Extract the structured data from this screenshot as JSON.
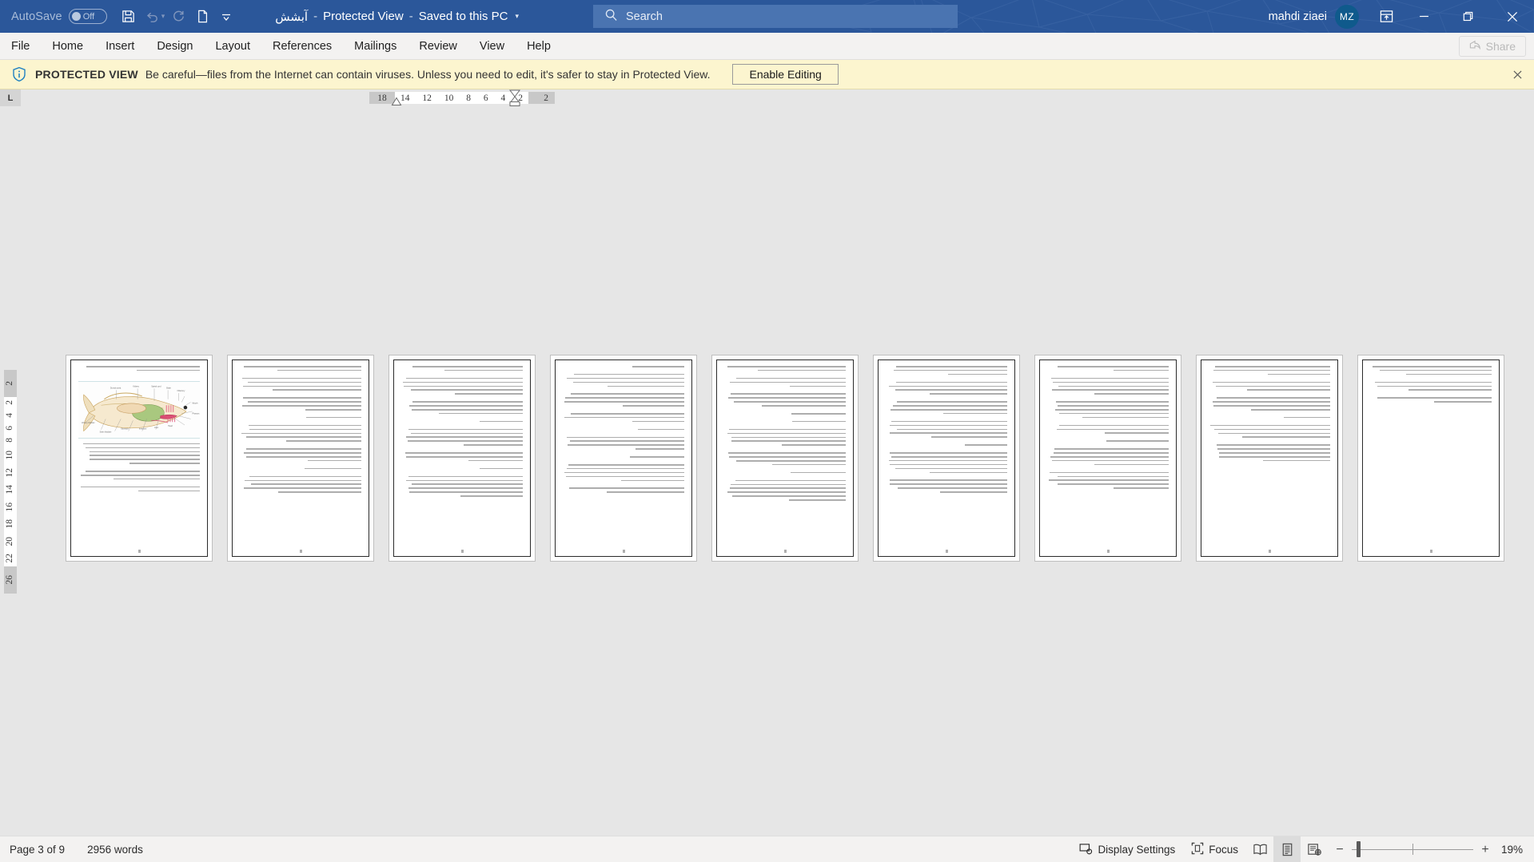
{
  "titlebar": {
    "autosave_label": "AutoSave",
    "autosave_state": "Off",
    "qat": [
      {
        "name": "save-button",
        "icon": "save-icon"
      },
      {
        "name": "undo-button",
        "icon": "undo-icon"
      },
      {
        "name": "redo-button",
        "icon": "redo-icon"
      },
      {
        "name": "new-document-button",
        "icon": "new-document-icon"
      },
      {
        "name": "customize-quick-access-toolbar-button",
        "icon": "chevron-down-icon"
      }
    ],
    "doc_name": "آبشش",
    "sep1": "-",
    "protected_view_state": "Protected View",
    "sep2": "-",
    "save_location": "Saved to this PC",
    "title_caret": "▾",
    "account_name": "mahdi ziaei",
    "account_initials": "MZ",
    "ribbon_display_icon": "ribbon-display-options-icon",
    "minimize": "—",
    "restore": "❐",
    "close": "✕",
    "bg_color": "#2b579a",
    "accent_avatar": "#0f5a8c"
  },
  "search": {
    "placeholder": "Search",
    "icon": "search-icon"
  },
  "ribbon": {
    "tabs": [
      {
        "label": "File"
      },
      {
        "label": "Home"
      },
      {
        "label": "Insert"
      },
      {
        "label": "Design"
      },
      {
        "label": "Layout"
      },
      {
        "label": "References"
      },
      {
        "label": "Mailings"
      },
      {
        "label": "Review"
      },
      {
        "label": "View"
      },
      {
        "label": "Help"
      }
    ],
    "share_label": "Share",
    "share_icon": "share-icon",
    "share_disabled": true
  },
  "protected_view": {
    "icon": "shield-info-icon",
    "strong": "PROTECTED VIEW",
    "message": "Be careful—files from the Internet can contain viruses. Unless you need to edit, it's safer to stay in Protected View.",
    "button_label": "Enable Editing",
    "close_label": "✕",
    "bg_color": "#fcf5cf"
  },
  "ruler": {
    "tabstop_marker": "L",
    "horizontal_numbers": [
      "18",
      "14",
      "12",
      "10",
      "8",
      "6",
      "4",
      "2",
      "2"
    ],
    "vertical_left_number": "2",
    "vertical_numbers": [
      "2",
      "4",
      "6",
      "8",
      "10",
      "12",
      "14",
      "16",
      "18",
      "20",
      "22"
    ],
    "vertical_bottom_number": "26"
  },
  "document": {
    "page_count": 9,
    "pages": [
      {
        "index": 1,
        "has_figure": true,
        "figure_name": "fish-anatomy-diagram",
        "para_blocks": [
          2,
          6,
          3,
          2
        ]
      },
      {
        "index": 2,
        "has_figure": false,
        "para_blocks": [
          2,
          4,
          4,
          1,
          5,
          4,
          1,
          5
        ]
      },
      {
        "index": 3,
        "has_figure": false,
        "para_blocks": [
          2,
          5,
          4,
          1,
          5,
          3,
          1,
          6
        ]
      },
      {
        "index": 4,
        "has_figure": false,
        "para_blocks": [
          1,
          4,
          4,
          3,
          1,
          4,
          1,
          5,
          2
        ]
      },
      {
        "index": 5,
        "has_figure": false,
        "para_blocks": [
          2,
          3,
          4,
          1,
          1,
          5,
          4,
          1,
          6
        ]
      },
      {
        "index": 6,
        "has_figure": false,
        "para_blocks": [
          3,
          4,
          4,
          5,
          1,
          6,
          4
        ]
      },
      {
        "index": 7,
        "has_figure": false,
        "para_blocks": [
          2,
          5,
          5,
          3,
          1,
          5,
          5
        ]
      },
      {
        "index": 8,
        "has_figure": false,
        "para_blocks": [
          3,
          3,
          4,
          1,
          4,
          5
        ]
      },
      {
        "index": 9,
        "has_figure": false,
        "para_blocks": [
          3,
          3,
          2
        ]
      }
    ]
  },
  "statusbar": {
    "page_indicator": "Page 3 of 9",
    "word_count": "2956 words",
    "display_settings_label": "Display Settings",
    "display_settings_icon": "display-settings-icon",
    "focus_label": "Focus",
    "focus_icon": "focus-icon",
    "views": [
      {
        "name": "read-mode-view-button",
        "icon": "read-mode-icon",
        "active": false
      },
      {
        "name": "print-layout-view-button",
        "icon": "print-layout-icon",
        "active": true
      },
      {
        "name": "web-layout-view-button",
        "icon": "web-layout-icon",
        "active": false
      }
    ],
    "zoom_out": "−",
    "zoom_in": "+",
    "zoom_level": "19%"
  }
}
